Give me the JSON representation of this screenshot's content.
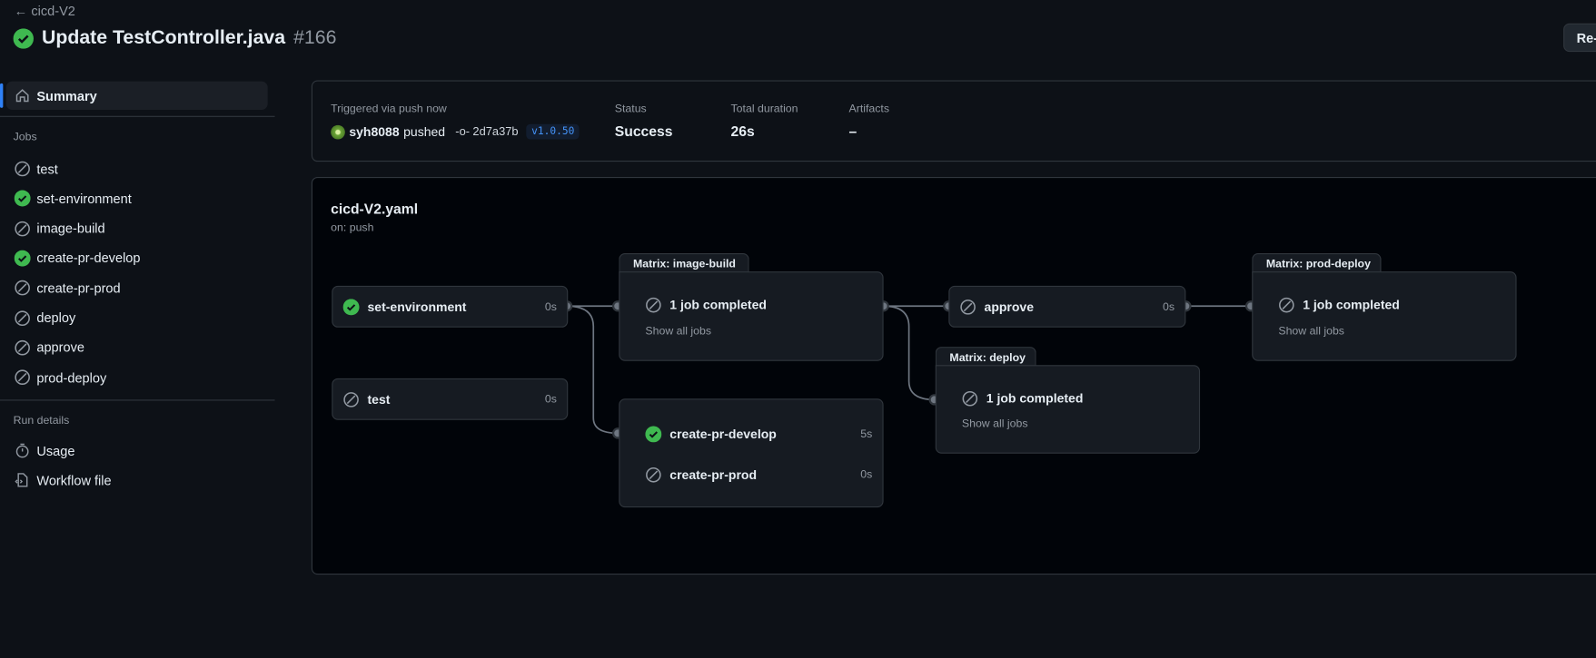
{
  "header": {
    "back_label": "cicd-V2",
    "title": "Update TestController.java",
    "run_number": "#166",
    "rerun_label": "Re-"
  },
  "sidebar": {
    "summary_label": "Summary",
    "jobs_heading": "Jobs",
    "jobs": [
      {
        "label": "test",
        "status": "skipped"
      },
      {
        "label": "set-environment",
        "status": "success"
      },
      {
        "label": "image-build",
        "status": "skipped"
      },
      {
        "label": "create-pr-develop",
        "status": "success"
      },
      {
        "label": "create-pr-prod",
        "status": "skipped"
      },
      {
        "label": "deploy",
        "status": "skipped"
      },
      {
        "label": "approve",
        "status": "skipped"
      },
      {
        "label": "prod-deploy",
        "status": "skipped"
      }
    ],
    "run_details_heading": "Run details",
    "usage_label": "Usage",
    "workflow_file_label": "Workflow file"
  },
  "summary": {
    "trigger_label": "Triggered via push now",
    "actor": "syh8088",
    "action": "pushed",
    "commit": "2d7a37b",
    "tag": "v1.0.50",
    "status_label": "Status",
    "status_value": "Success",
    "duration_label": "Total duration",
    "duration_value": "26s",
    "artifacts_label": "Artifacts",
    "artifacts_value": "–"
  },
  "graph": {
    "file": "cicd-V2.yaml",
    "trigger": "on: push",
    "set_environment": {
      "label": "set-environment",
      "duration": "0s"
    },
    "test": {
      "label": "test",
      "duration": "0s"
    },
    "image_build": {
      "matrix_label": "Matrix: image-build",
      "summary": "1 job completed",
      "show_all": "Show all jobs"
    },
    "create_pr_develop": {
      "label": "create-pr-develop",
      "duration": "5s"
    },
    "create_pr_prod": {
      "label": "create-pr-prod",
      "duration": "0s"
    },
    "approve": {
      "label": "approve",
      "duration": "0s"
    },
    "deploy": {
      "matrix_label": "Matrix: deploy",
      "summary": "1 job completed",
      "show_all": "Show all jobs"
    },
    "prod_deploy": {
      "matrix_label": "Matrix: prod-deploy",
      "summary": "1 job completed",
      "show_all": "Show all jobs"
    }
  },
  "colors": {
    "success": "#3fb950",
    "accent": "#2f81f7",
    "muted": "#9198a1"
  }
}
